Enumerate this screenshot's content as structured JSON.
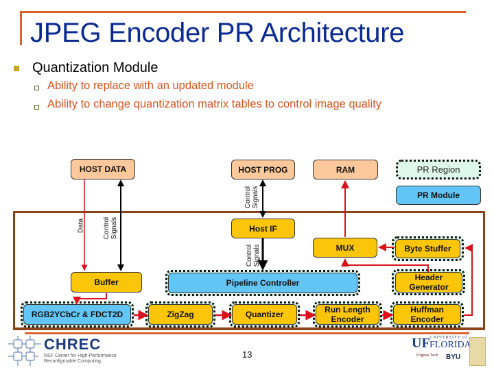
{
  "slide": {
    "title": "JPEG Encoder PR Architecture",
    "bullet_main": "Quantization Module",
    "sub_bullets": [
      "Ability to replace with an updated module",
      "Ability to change quantization matrix tables to control image quality"
    ],
    "page_number": "13",
    "colors": {
      "title": "#0a2a8f",
      "accent_line": "#d9622b",
      "sub_bullet_text": "#d4561f",
      "frame": "#8a4319",
      "host_box": "#fbc89c",
      "static_module": "#fbc60a",
      "pr_module": "#63c4f6",
      "pr_region": "#dff8ec",
      "data_wire": "#d8111b",
      "control_wire": "#000000"
    }
  },
  "diagram": {
    "host_blocks": {
      "host_data": "HOST DATA",
      "host_prog": "HOST PROG",
      "ram": "RAM"
    },
    "legend": {
      "pr_region": "PR Region",
      "pr_module": "PR Module"
    },
    "signal_labels": {
      "data": "Data",
      "control_a": "Control",
      "control_b": "Signals"
    },
    "modules": {
      "host_if": "Host IF",
      "mux": "MUX",
      "byte_stuffer": "Byte Stuffer",
      "buffer": "Buffer",
      "pipeline_controller": "Pipeline Controller",
      "header_generator_1": "Header",
      "header_generator_2": "Generator",
      "rgb2ycbcr_fdct2d": "RGB2YCbCr & FDCT2D",
      "zigzag": "ZigZag",
      "quantizer": "Quantizer",
      "run_length_1": "Run Length",
      "run_length_2": "Encoder",
      "huffman_1": "Huffman",
      "huffman_2": "Encoder"
    }
  },
  "footer": {
    "chrec_name": "CHREC",
    "chrec_tagline_1": "NSF Center for High-Performance",
    "chrec_tagline_2": "Reconfigurable Computing",
    "uf_mark": "UF",
    "uf_university": "UNIVERSITY of",
    "uf_florida": "FLORIDA",
    "vt": "Virginia Tech",
    "byu": "BYU"
  }
}
